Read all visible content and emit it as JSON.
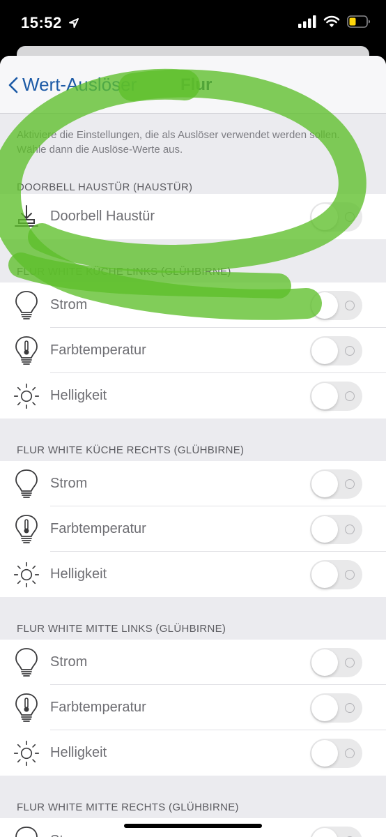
{
  "status": {
    "time": "15:52",
    "icons": [
      "location-arrow-icon",
      "signal-icon",
      "wifi-icon",
      "battery-icon"
    ],
    "battery_color": "#ffd60a"
  },
  "nav": {
    "back_label": "Wert-Auslöser",
    "title": "Flur"
  },
  "intro": "Aktiviere die Einstellungen, die als Auslöser verwendet werden sollen. Wähle dann die Auslöse-Werte aus.",
  "colors": {
    "accent": "#1c5aa6",
    "scribble": "#5dbf2a",
    "toggle_off": "#e9e9ea"
  },
  "sections": [
    {
      "header": "DOORBELL HAUSTÜR (HAUSTÜR)",
      "rows": [
        {
          "icon": "doorbell-icon",
          "label": "Doorbell Haustür",
          "on": false
        }
      ]
    },
    {
      "header": "FLUR WHITE KÜCHE LINKS (GLÜHBIRNE)",
      "rows": [
        {
          "icon": "bulb-icon",
          "label": "Strom",
          "on": false
        },
        {
          "icon": "bulb-thermometer-icon",
          "label": "Farbtemperatur",
          "on": false
        },
        {
          "icon": "sun-icon",
          "label": "Helligkeit",
          "on": false
        }
      ]
    },
    {
      "header": "FLUR WHITE KÜCHE RECHTS (GLÜHBIRNE)",
      "rows": [
        {
          "icon": "bulb-icon",
          "label": "Strom",
          "on": false
        },
        {
          "icon": "bulb-thermometer-icon",
          "label": "Farbtemperatur",
          "on": false
        },
        {
          "icon": "sun-icon",
          "label": "Helligkeit",
          "on": false
        }
      ]
    },
    {
      "header": "FLUR WHITE MITTE LINKS (GLÜHBIRNE)",
      "rows": [
        {
          "icon": "bulb-icon",
          "label": "Strom",
          "on": false
        },
        {
          "icon": "bulb-thermometer-icon",
          "label": "Farbtemperatur",
          "on": false
        },
        {
          "icon": "sun-icon",
          "label": "Helligkeit",
          "on": false
        }
      ]
    },
    {
      "header": "FLUR WHITE MITTE RECHTS (GLÜHBIRNE)",
      "rows": [
        {
          "icon": "bulb-icon",
          "label": "Strom",
          "on": false
        }
      ]
    }
  ]
}
